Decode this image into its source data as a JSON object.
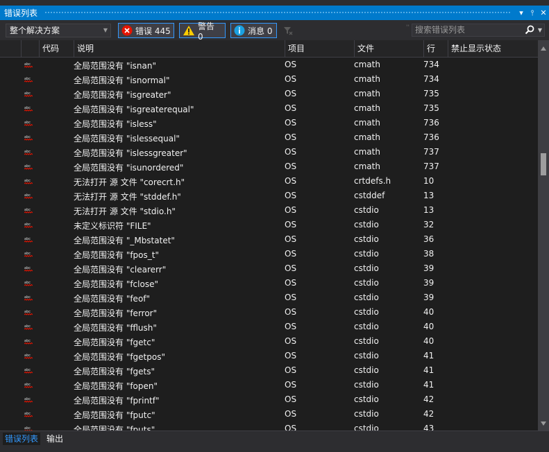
{
  "window": {
    "title": "错误列表",
    "buttons": {
      "dropdown": "▾",
      "pin": "⫯",
      "close": "✕"
    }
  },
  "toolbar": {
    "scope_value": "整个解决方案",
    "errors_label": "错误 445",
    "warnings_label": "警告 0",
    "messages_label": "消息 0",
    "search_placeholder": "搜索错误列表"
  },
  "columns": {
    "code": "代码",
    "description": "说明",
    "project": "项目",
    "file": "文件",
    "line": "行",
    "suppression": "禁止显示状态"
  },
  "rows": [
    {
      "icon": "squiggle-error-icon",
      "description": "全局范围没有 \"isnan\"",
      "project": "OS",
      "file": "cmath",
      "line": "734"
    },
    {
      "icon": "squiggle-error-icon",
      "description": "全局范围没有 \"isnormal\"",
      "project": "OS",
      "file": "cmath",
      "line": "734"
    },
    {
      "icon": "squiggle-error-icon",
      "description": "全局范围没有 \"isgreater\"",
      "project": "OS",
      "file": "cmath",
      "line": "735"
    },
    {
      "icon": "squiggle-error-icon",
      "description": "全局范围没有 \"isgreaterequal\"",
      "project": "OS",
      "file": "cmath",
      "line": "735"
    },
    {
      "icon": "squiggle-error-icon",
      "description": "全局范围没有 \"isless\"",
      "project": "OS",
      "file": "cmath",
      "line": "736"
    },
    {
      "icon": "squiggle-error-icon",
      "description": "全局范围没有 \"islessequal\"",
      "project": "OS",
      "file": "cmath",
      "line": "736"
    },
    {
      "icon": "squiggle-error-icon",
      "description": "全局范围没有 \"islessgreater\"",
      "project": "OS",
      "file": "cmath",
      "line": "737"
    },
    {
      "icon": "squiggle-error-icon",
      "description": "全局范围没有 \"isunordered\"",
      "project": "OS",
      "file": "cmath",
      "line": "737"
    },
    {
      "icon": "squiggle-error-icon",
      "description": "无法打开 源 文件 \"corecrt.h\"",
      "project": "OS",
      "file": "crtdefs.h",
      "line": "10"
    },
    {
      "icon": "squiggle-error-icon",
      "description": "无法打开 源 文件 \"stddef.h\"",
      "project": "OS",
      "file": "cstddef",
      "line": "13"
    },
    {
      "icon": "squiggle-error-icon",
      "description": "无法打开 源 文件 \"stdio.h\"",
      "project": "OS",
      "file": "cstdio",
      "line": "13"
    },
    {
      "icon": "squiggle-error-icon",
      "description": "未定义标识符 \"FILE\"",
      "project": "OS",
      "file": "cstdio",
      "line": "32"
    },
    {
      "icon": "squiggle-error-icon",
      "description": "全局范围没有 \"_Mbstatet\"",
      "project": "OS",
      "file": "cstdio",
      "line": "36"
    },
    {
      "icon": "squiggle-error-icon",
      "description": "全局范围没有 \"fpos_t\"",
      "project": "OS",
      "file": "cstdio",
      "line": "38"
    },
    {
      "icon": "squiggle-error-icon",
      "description": "全局范围没有 \"clearerr\"",
      "project": "OS",
      "file": "cstdio",
      "line": "39"
    },
    {
      "icon": "squiggle-error-icon",
      "description": "全局范围没有 \"fclose\"",
      "project": "OS",
      "file": "cstdio",
      "line": "39"
    },
    {
      "icon": "squiggle-error-icon",
      "description": "全局范围没有 \"feof\"",
      "project": "OS",
      "file": "cstdio",
      "line": "39"
    },
    {
      "icon": "squiggle-error-icon",
      "description": "全局范围没有 \"ferror\"",
      "project": "OS",
      "file": "cstdio",
      "line": "40"
    },
    {
      "icon": "squiggle-error-icon",
      "description": "全局范围没有 \"fflush\"",
      "project": "OS",
      "file": "cstdio",
      "line": "40"
    },
    {
      "icon": "squiggle-error-icon",
      "description": "全局范围没有 \"fgetc\"",
      "project": "OS",
      "file": "cstdio",
      "line": "40"
    },
    {
      "icon": "squiggle-error-icon",
      "description": "全局范围没有 \"fgetpos\"",
      "project": "OS",
      "file": "cstdio",
      "line": "41"
    },
    {
      "icon": "squiggle-error-icon",
      "description": "全局范围没有 \"fgets\"",
      "project": "OS",
      "file": "cstdio",
      "line": "41"
    },
    {
      "icon": "squiggle-error-icon",
      "description": "全局范围没有 \"fopen\"",
      "project": "OS",
      "file": "cstdio",
      "line": "41"
    },
    {
      "icon": "squiggle-error-icon",
      "description": "全局范围没有 \"fprintf\"",
      "project": "OS",
      "file": "cstdio",
      "line": "42"
    },
    {
      "icon": "squiggle-error-icon",
      "description": "全局范围没有 \"fputc\"",
      "project": "OS",
      "file": "cstdio",
      "line": "42"
    },
    {
      "icon": "squiggle-error-icon",
      "description": "全局范围没有 \"fputs\"",
      "project": "OS",
      "file": "cstdio",
      "line": "43"
    }
  ],
  "tabs": [
    {
      "label": "错误列表",
      "active": true
    },
    {
      "label": "输出",
      "active": false
    }
  ],
  "colors": {
    "accent": "#007acc",
    "background": "#1e1e1e",
    "toolbar": "#2d2d30",
    "error_red": "#e51400",
    "warning_yellow": "#ffcc00",
    "info_blue": "#1ba1e2"
  }
}
